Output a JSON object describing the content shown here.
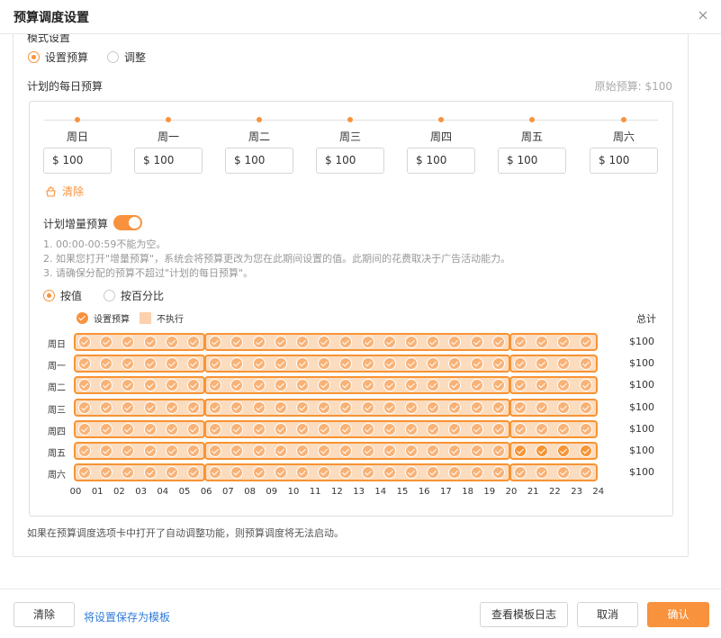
{
  "modal": {
    "title": "预算调度设置",
    "close_icon": "close-icon"
  },
  "mode": {
    "section_label": "模式设置",
    "options": [
      {
        "label": "设置预算",
        "selected": true
      },
      {
        "label": "调整",
        "selected": false
      }
    ]
  },
  "daily_budget": {
    "section_label": "计划的每日预算",
    "original_budget": "原始预算: $100",
    "days": [
      {
        "label": "周日",
        "currency": "$",
        "value": "100"
      },
      {
        "label": "周一",
        "currency": "$",
        "value": "100"
      },
      {
        "label": "周二",
        "currency": "$",
        "value": "100"
      },
      {
        "label": "周三",
        "currency": "$",
        "value": "100"
      },
      {
        "label": "周四",
        "currency": "$",
        "value": "100"
      },
      {
        "label": "周五",
        "currency": "$",
        "value": "100"
      },
      {
        "label": "周六",
        "currency": "$",
        "value": "100"
      }
    ],
    "clear_label": "清除"
  },
  "incremental": {
    "toggle_label": "计划增量预算",
    "enabled": true,
    "notes": [
      "1. 00:00-00:59不能为空。",
      "2. 如果您打开\"增量预算\"，系统会将预算更改为您在此期间设置的值。此期间的花费取决于广告活动能力。",
      "3. 请确保分配的预算不超过\"计划的每日预算\"。"
    ],
    "method_options": [
      {
        "label": "按值",
        "selected": true
      },
      {
        "label": "按百分比",
        "selected": false
      }
    ]
  },
  "schedule": {
    "legend_set": "设置预算",
    "legend_skip": "不执行",
    "total_header": "总计",
    "rows": [
      {
        "day": "周日",
        "total": "$100"
      },
      {
        "day": "周一",
        "total": "$100"
      },
      {
        "day": "周二",
        "total": "$100"
      },
      {
        "day": "周三",
        "total": "$100"
      },
      {
        "day": "周四",
        "total": "$100"
      },
      {
        "day": "周五",
        "total": "$100"
      },
      {
        "day": "周六",
        "total": "$100"
      }
    ],
    "hours": [
      "00",
      "01",
      "02",
      "03",
      "04",
      "05",
      "06",
      "07",
      "08",
      "09",
      "10",
      "11",
      "12",
      "13",
      "14",
      "15",
      "16",
      "17",
      "18",
      "19",
      "20",
      "21",
      "22",
      "23",
      "24"
    ]
  },
  "bottom_note": "如果在预算调度选项卡中打开了自动调整功能，则预算调度将无法启动。",
  "footer": {
    "clear": "清除",
    "save_template": "将设置保存为模板",
    "view_log": "查看模板日志",
    "cancel": "取消",
    "confirm": "确认"
  },
  "colors": {
    "accent": "#f8923c",
    "link": "#2f7bd8"
  }
}
